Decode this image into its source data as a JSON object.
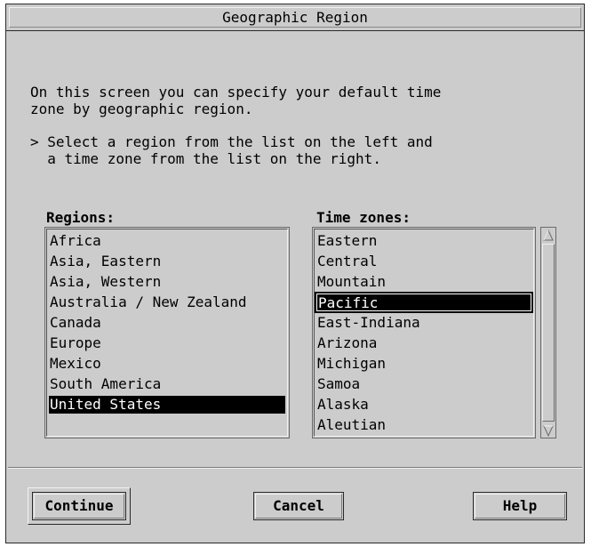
{
  "dialog": {
    "title": "Geographic Region"
  },
  "instructions": {
    "line1": "On this screen you can specify your default time",
    "line2": "zone by geographic region.",
    "bullet_line1": "> Select a region from the list on the left and",
    "bullet_line2": "  a time zone from the list on the right."
  },
  "regions": {
    "label": "Regions:",
    "items": [
      "Africa",
      "Asia, Eastern",
      "Asia, Western",
      "Australia / New Zealand",
      "Canada",
      "Europe",
      "Mexico",
      "South America",
      "United States"
    ],
    "selected": "United States"
  },
  "timezones": {
    "label": "Time zones:",
    "items": [
      "Eastern",
      "Central",
      "Mountain",
      "Pacific",
      "East-Indiana",
      "Arizona",
      "Michigan",
      "Samoa",
      "Alaska",
      "Aleutian"
    ],
    "selected": "Pacific"
  },
  "buttons": {
    "continue": "Continue",
    "cancel": "Cancel",
    "help": "Help"
  },
  "colors": {
    "background": "#cccccc",
    "selection": "#000000",
    "selection_text": "#ffffff"
  }
}
